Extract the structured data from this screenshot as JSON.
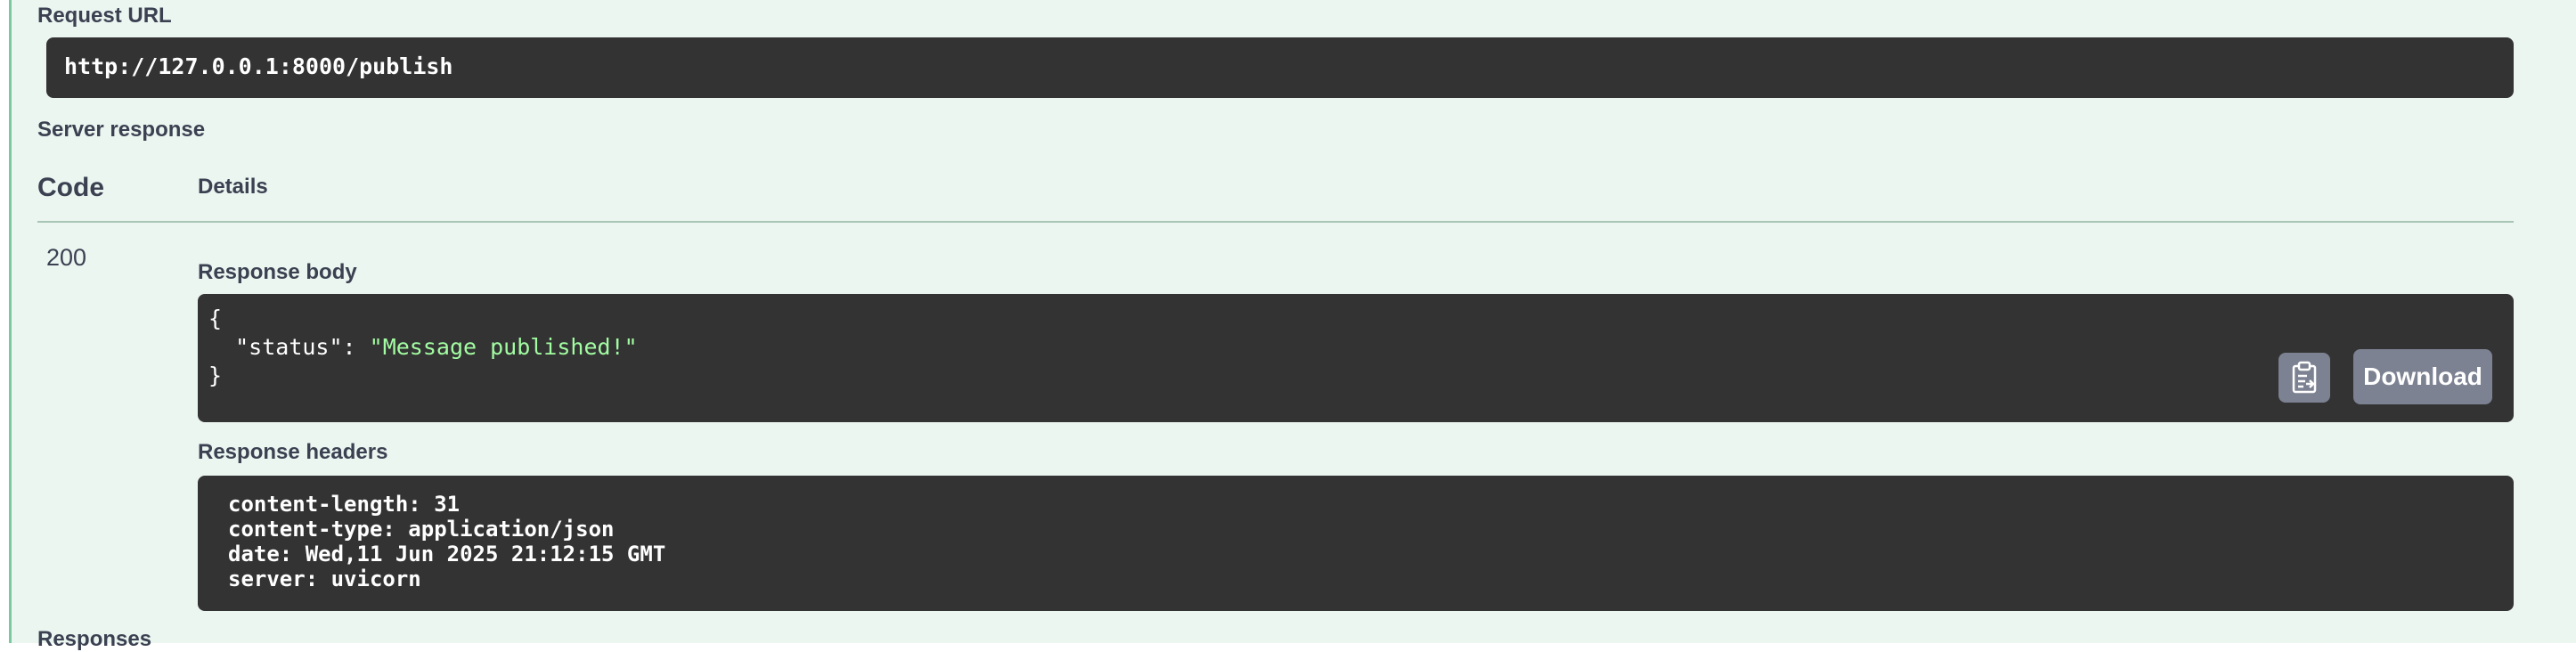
{
  "request_url": {
    "label": "Request URL",
    "value": "http://127.0.0.1:8000/publish"
  },
  "server_response": {
    "label": "Server response",
    "col_code": "Code",
    "col_details": "Details",
    "code": "200",
    "response_body": {
      "label": "Response body",
      "open_brace": "{",
      "key": "\"status\"",
      "colon": ": ",
      "value": "\"Message published!\"",
      "close_brace": "}",
      "copy_icon": "clipboard-icon",
      "download_label": "Download"
    },
    "response_headers": {
      "label": "Response headers",
      "lines": [
        "content-length: 31",
        "content-type: application/json",
        "date: Wed,11 Jun 2025 21:12:15 GMT",
        "server: uvicorn"
      ]
    }
  },
  "responses_label": "Responses",
  "colors": {
    "panel_bg": "#ecf6f1",
    "panel_border": "#7cc8a0",
    "code_bg": "#333333",
    "string_green": "#a2fca2",
    "button_gray": "#7d8293",
    "label_text": "#3b4151"
  }
}
